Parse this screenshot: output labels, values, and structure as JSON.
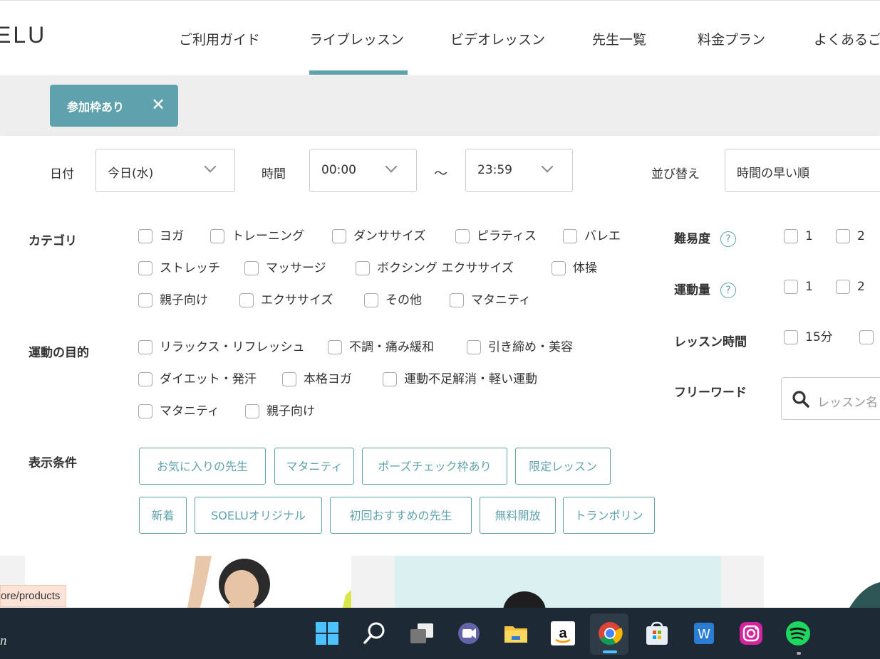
{
  "header": {
    "logo": "ELU",
    "nav": [
      "ご利用ガイド",
      "ライブレッスン",
      "ビデオレッスン",
      "先生一覧",
      "料金プラン",
      "よくあるご"
    ],
    "active_index": 1
  },
  "active_filter": {
    "label": "参加枠あり",
    "remove": "✕"
  },
  "filters": {
    "date_label": "日付",
    "date_value": "今日(水)",
    "time_label": "時間",
    "time_from": "00:00",
    "time_sep": "〜",
    "time_to": "23:59",
    "sort_label": "並び替え",
    "sort_value": "時間の早い順"
  },
  "category": {
    "label": "カテゴリ",
    "options": [
      "ヨガ",
      "トレーニング",
      "ダンササイズ",
      "ピラティス",
      "バレエ",
      "ストレッチ",
      "マッサージ",
      "ボクシング エクササイズ",
      "体操",
      "親子向け",
      "エクササイズ",
      "その他",
      "マタニティ"
    ]
  },
  "purpose": {
    "label": "運動の目的",
    "options": [
      "リラックス・リフレッシュ",
      "不調・痛み緩和",
      "引き締め・美容",
      "ダイエット・発汗",
      "本格ヨガ",
      "運動不足解消・軽い運動",
      "マタニティ",
      "親子向け"
    ]
  },
  "display": {
    "label": "表示条件",
    "tags": [
      "お気に入りの先生",
      "マタニティ",
      "ポーズチェック枠あり",
      "限定レッスン",
      "新着",
      "SOELUオリジナル",
      "初回おすすめの先生",
      "無料開放",
      "トランポリン"
    ]
  },
  "difficulty": {
    "label": "難易度",
    "help": "?",
    "options": [
      "1",
      "2"
    ]
  },
  "exercise": {
    "label": "運動量",
    "help": "?",
    "options": [
      "1",
      "2"
    ]
  },
  "duration": {
    "label": "レッスン時間",
    "options": [
      "15分"
    ]
  },
  "freeword": {
    "label": "フリーワード",
    "placeholder": "レッスン名"
  },
  "url_tooltip": "ore/products",
  "taskbar": {
    "left_text": "n",
    "icons": [
      "windows-start-icon",
      "search-icon",
      "task-view-icon",
      "teams-chat-icon",
      "file-explorer-icon",
      "amazon-icon",
      "chrome-icon",
      "microsoft-store-icon",
      "word-icon",
      "instagram-icon",
      "spotify-icon"
    ],
    "accent": "#4cc2ff"
  },
  "colors": {
    "accent": "#5fa2ad",
    "chip_bar": "#eeeeee",
    "taskbar": "#1d2a35"
  }
}
